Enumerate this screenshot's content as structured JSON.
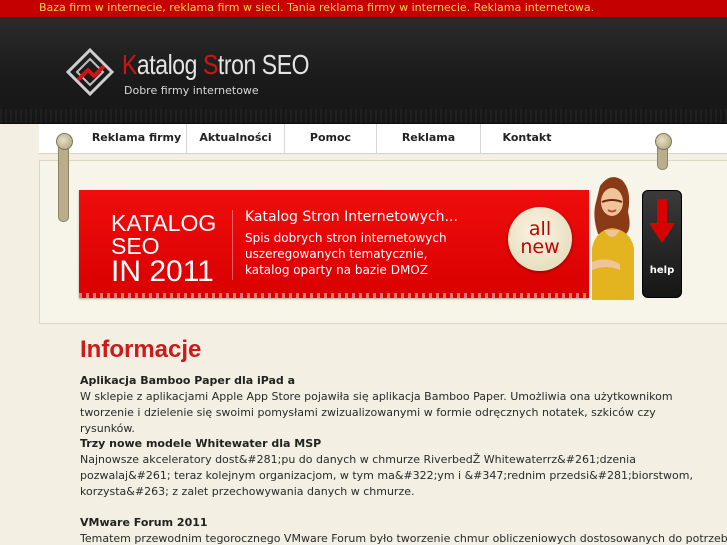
{
  "topbar": {
    "text": "Baza firm w internecie, reklama firm w sieci. Tania reklama firmy w internecie. Reklama internetowa."
  },
  "header": {
    "logo_title_prefix_1": "K",
    "logo_title_part_1": "atalog ",
    "logo_title_prefix_2": "S",
    "logo_title_part_2": "tron SEO",
    "logo_subtitle": "Dobre firmy internetowe"
  },
  "nav": {
    "items": [
      {
        "label": "Reklama firmy"
      },
      {
        "label": "Aktualności"
      },
      {
        "label": "Pomoc"
      },
      {
        "label": "Reklama"
      },
      {
        "label": "Kontakt"
      }
    ]
  },
  "banner": {
    "line1": "KATALOG",
    "line2": "SEO",
    "line3": "IN 2011",
    "headline": "Katalog Stron Internetowych...",
    "description": "Spis dobrych stron internetowych uszeregowanych tematycznie, katalog oparty na bazie DMOZ",
    "badge_line1": "all",
    "badge_line2": "new",
    "help_label": "help"
  },
  "main": {
    "section_title": "Informacje",
    "articles": [
      {
        "title": "Aplikacja Bamboo Paper dla iPad a",
        "body": "W sklepie z aplikacjami Apple App Store pojawiła się aplikacja Bamboo Paper.  Umożliwia ona użytkownikom tworzenie i dzielenie się swoimi pomysłami zwizualizowanymi w formie odręcznych notatek, szkiców czy rysunków."
      },
      {
        "title": "Trzy nowe modele Whitewater dla MSP",
        "body": "Najnowsze akceleratory dost&#281;pu do danych w chmurze  RiverbedŽ Whitewaterrz&#261;dzenia pozwalaj&#261; teraz kolejnym organizacjom, w tym ma&#322;ym i &#347;rednim przedsi&#281;biorstwom, korzysta&#263; z zalet przechowywania danych w chmurze."
      },
      {
        "title": "VMware Forum 2011",
        "body": "Tematem przewodnim tegorocznego VMware Forum było tworzenie chmur obliczeniowych dostosowanych do potrzeb"
      }
    ]
  },
  "colors": {
    "accent_red": "#cc1b1b",
    "topbar_text": "#ffd24a"
  }
}
